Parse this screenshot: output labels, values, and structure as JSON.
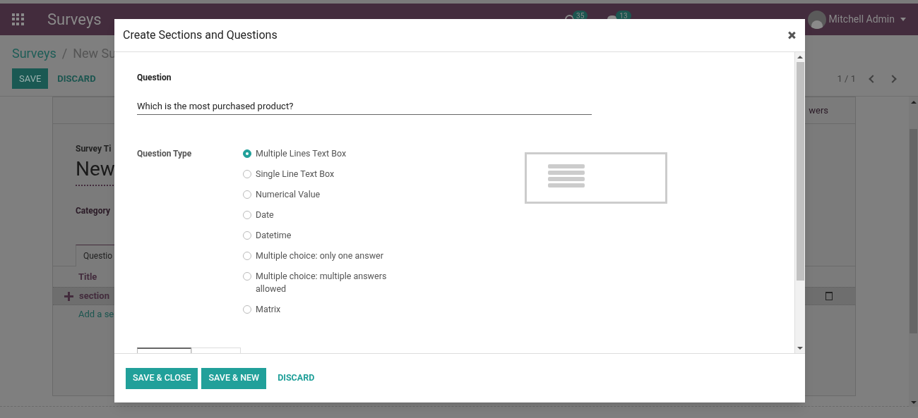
{
  "navbar": {
    "app_title": "Surveys",
    "activity_count": "35",
    "message_count": "13",
    "user": "Mitchell Admin"
  },
  "control_panel": {
    "breadcrumb": [
      "Surveys",
      "/",
      "New Su"
    ],
    "save_button": "SAVE",
    "discard_button": "DISCARD",
    "pager": "1 / 1"
  },
  "form": {
    "survey_title_label": "Survey Ti",
    "survey_title": "New",
    "category_label": "Category",
    "tab": "Questio",
    "button_box_text": "wers",
    "table": {
      "column": "Title",
      "row": "section",
      "add_link": "Add a se"
    }
  },
  "dialog": {
    "title": "Create Sections and Questions",
    "question_label": "Question",
    "question_value": "Which is the most purchased product?",
    "question_type_label": "Question Type",
    "options": [
      {
        "label": "Multiple Lines Text Box",
        "selected": true
      },
      {
        "label": "Single Line Text Box",
        "selected": false
      },
      {
        "label": "Numerical Value",
        "selected": false
      },
      {
        "label": "Date",
        "selected": false
      },
      {
        "label": "Datetime",
        "selected": false
      },
      {
        "label": "Multiple choice: only one answer",
        "selected": false
      },
      {
        "label": "Multiple choice: multiple answers allowed",
        "selected": false
      },
      {
        "label": "Matrix",
        "selected": false
      }
    ],
    "buttons": [
      {
        "label": "SAVE & CLOSE",
        "kind": "primary"
      },
      {
        "label": "SAVE & NEW",
        "kind": "primary"
      },
      {
        "label": "DISCARD",
        "kind": "link"
      }
    ]
  }
}
